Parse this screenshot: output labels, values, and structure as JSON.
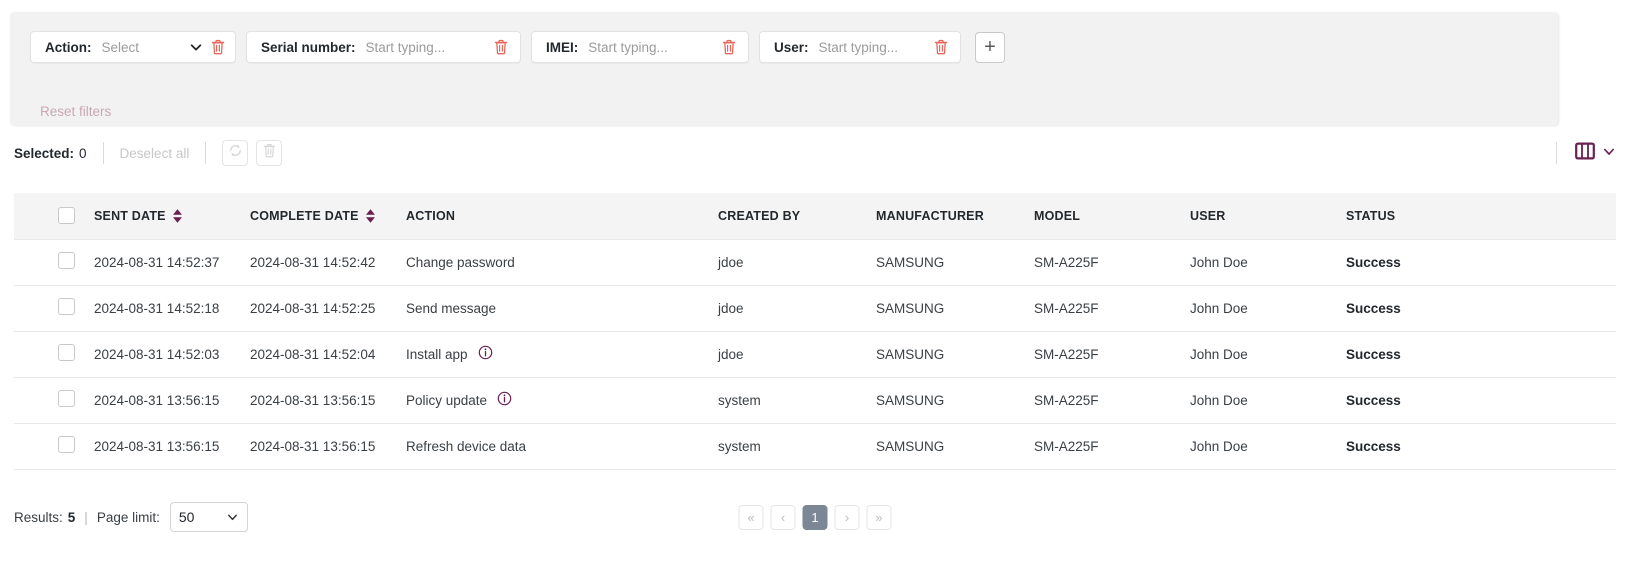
{
  "filters": {
    "chips": [
      {
        "label": "Action:",
        "value": "Select",
        "has_caret": true,
        "name": "action"
      },
      {
        "label": "Serial number:",
        "value": "Start typing...",
        "has_caret": false,
        "name": "serial-number"
      },
      {
        "label": "IMEI:",
        "value": "Start typing...",
        "has_caret": false,
        "name": "imei"
      },
      {
        "label": "User:",
        "value": "Start typing...",
        "has_caret": false,
        "name": "user"
      }
    ],
    "add_filter_label": "+",
    "reset_label": "Reset filters"
  },
  "toolbar": {
    "selected_label": "Selected:",
    "selected_count": "0",
    "deselect_all_label": "Deselect all",
    "refresh_icon": "refresh-icon",
    "delete_icon": "trash-icon",
    "columns_icon": "columns-icon",
    "columns_caret_icon": "chevron-down-icon"
  },
  "table": {
    "columns": [
      {
        "key": "checkbox",
        "label": "",
        "sortable": false
      },
      {
        "key": "sent_date",
        "label": "SENT DATE",
        "sortable": true
      },
      {
        "key": "complete_date",
        "label": "COMPLETE DATE",
        "sortable": true
      },
      {
        "key": "action",
        "label": "ACTION",
        "sortable": false
      },
      {
        "key": "created_by",
        "label": "CREATED BY",
        "sortable": false
      },
      {
        "key": "manufacturer",
        "label": "MANUFACTURER",
        "sortable": false
      },
      {
        "key": "model",
        "label": "MODEL",
        "sortable": false
      },
      {
        "key": "user",
        "label": "USER",
        "sortable": false
      },
      {
        "key": "status",
        "label": "STATUS",
        "sortable": false
      }
    ],
    "rows": [
      {
        "sent_date": "2024-08-31 14:52:37",
        "complete_date": "2024-08-31 14:52:42",
        "action": "Change password",
        "action_info": false,
        "created_by": "jdoe",
        "manufacturer": "SAMSUNG",
        "model": "SM-A225F",
        "user": "John Doe",
        "status": "Success"
      },
      {
        "sent_date": "2024-08-31 14:52:18",
        "complete_date": "2024-08-31 14:52:25",
        "action": "Send message",
        "action_info": false,
        "created_by": "jdoe",
        "manufacturer": "SAMSUNG",
        "model": "SM-A225F",
        "user": "John Doe",
        "status": "Success"
      },
      {
        "sent_date": "2024-08-31 14:52:03",
        "complete_date": "2024-08-31 14:52:04",
        "action": "Install app",
        "action_info": true,
        "created_by": "jdoe",
        "manufacturer": "SAMSUNG",
        "model": "SM-A225F",
        "user": "John Doe",
        "status": "Success"
      },
      {
        "sent_date": "2024-08-31 13:56:15",
        "complete_date": "2024-08-31 13:56:15",
        "action": "Policy update",
        "action_info": true,
        "created_by": "system",
        "manufacturer": "SAMSUNG",
        "model": "SM-A225F",
        "user": "John Doe",
        "status": "Success"
      },
      {
        "sent_date": "2024-08-31 13:56:15",
        "complete_date": "2024-08-31 13:56:15",
        "action": "Refresh device data",
        "action_info": false,
        "created_by": "system",
        "manufacturer": "SAMSUNG",
        "model": "SM-A225F",
        "user": "John Doe",
        "status": "Success"
      }
    ]
  },
  "footer": {
    "results_label": "Results:",
    "results_count": "5",
    "separator": "|",
    "page_limit_label": "Page limit:",
    "page_limit_value": "50",
    "pagination": [
      {
        "label": "«",
        "name": "first-page",
        "active": false
      },
      {
        "label": "‹",
        "name": "prev-page",
        "active": false
      },
      {
        "label": "1",
        "name": "page-1",
        "active": true
      },
      {
        "label": "›",
        "name": "next-page",
        "active": false
      },
      {
        "label": "»",
        "name": "last-page",
        "active": false
      }
    ]
  },
  "colors": {
    "accent_purple": "#6b1f52",
    "trash_red": "#e8675c",
    "panel_bg": "#f2f2f2",
    "active_page_bg": "#7b8794"
  }
}
